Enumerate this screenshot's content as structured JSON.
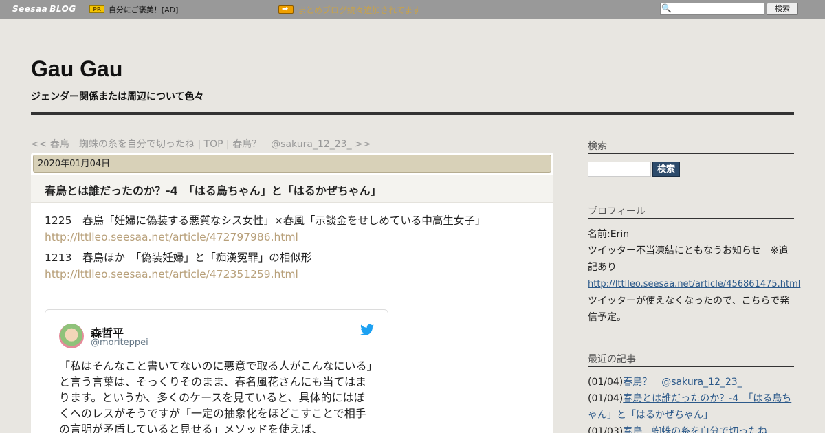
{
  "topbar": {
    "logo_main": "Seesaa",
    "logo_sub": "BLOG",
    "pr_badge": "PR",
    "ad_text": "自分にご褒美！[AD]",
    "promo_text": "まとめブログ続々追加されてます",
    "search_button": "検索"
  },
  "header": {
    "title": "Gau Gau",
    "description": "ジェンダー関係または周辺について色々"
  },
  "article_nav": {
    "prev": "<< 春鳥　蜘蛛の糸を自分で切ったね",
    "sep1": " | ",
    "top": "TOP",
    "sep2": " | ",
    "next": "春鳥？　@sakura_12_23_ >>"
  },
  "post": {
    "date": "2020年01月04日",
    "title": "春鳥とは誰だったのか？-4　「はる鳥ちゃん」と「はるかぜちゃん」",
    "lines": [
      "1225　春鳥「妊婦に偽装する悪質なシス女性」×春風「示談金をせしめている中高生女子」",
      "1213　春鳥ほか　「偽装妊婦」と「痴漢冤罪」の相似形"
    ],
    "links": [
      "http://lttlleo.seesaa.net/article/472797986.html",
      "http://lttlleo.seesaa.net/article/472351259.html"
    ],
    "tweet": {
      "name": "森哲平",
      "handle": "@moriteppei",
      "text": "「私はそんなこと書いてないのに悪意で取る人がこんなにいる」と言う言葉は、そっくりそのまま、春名風花さんにも当てはまります。というか、多くのケースを見ていると、具体的にはぼくへのレスがそうですが「一定の抽象化をほどこすことで相手の言明が矛盾していると見せる」メソッドを使えば、"
    }
  },
  "sidebar": {
    "search_heading": "検索",
    "search_button": "検索",
    "profile_heading": "プロフィール",
    "profile_name": "名前:Erin",
    "profile_note": "ツイッター不当凍結にともなうお知らせ　※追記あり",
    "profile_link": "http://lttlleo.seesaa.net/article/456861475.html",
    "profile_tail": "ツイッターが使えなくなったので、こちらで発信予定。",
    "recent_heading": "最近の記事",
    "recent": [
      {
        "date": "(01/04)",
        "title": "春鳥？　@sakura_12_23_"
      },
      {
        "date": "(01/04)",
        "title": "春鳥とは誰だったのか？-4　「はる鳥ちゃん」と「はるかぜちゃん」"
      },
      {
        "date": "(01/03)",
        "title": "春鳥　蜘蛛の糸を自分で切ったね"
      }
    ]
  }
}
